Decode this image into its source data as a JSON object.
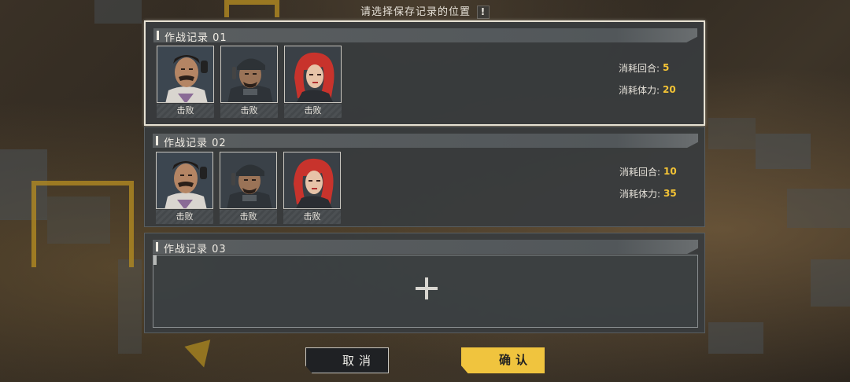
{
  "header": {
    "title": "请选择保存记录的位置",
    "badge": "!"
  },
  "records": [
    {
      "title": "作战记录  01",
      "selected": true,
      "portraits": [
        {
          "character": "mustached-man-portrait",
          "status": "击败"
        },
        {
          "character": "cap-soldier-portrait",
          "status": "击败"
        },
        {
          "character": "red-haired-woman-portrait",
          "status": "击败"
        }
      ],
      "stats": [
        {
          "label": "消耗回合:",
          "value": "5"
        },
        {
          "label": "消耗体力:",
          "value": "20"
        }
      ]
    },
    {
      "title": "作战记录  02",
      "selected": false,
      "portraits": [
        {
          "character": "mustached-man-portrait",
          "status": "击败"
        },
        {
          "character": "cap-soldier-portrait",
          "status": "击败"
        },
        {
          "character": "red-haired-woman-portrait",
          "status": "击败"
        }
      ],
      "stats": [
        {
          "label": "消耗回合:",
          "value": "10"
        },
        {
          "label": "消耗体力:",
          "value": "35"
        }
      ]
    },
    {
      "title": "作战记录  03",
      "empty": true,
      "add_icon": "plus-icon"
    }
  ],
  "buttons": {
    "cancel": "取消",
    "confirm": "确认"
  },
  "colors": {
    "accent": "#f0c43e",
    "value_text": "#f5c435",
    "panel_bg": "#383c3e",
    "selected_border": "#e6e1d3"
  }
}
